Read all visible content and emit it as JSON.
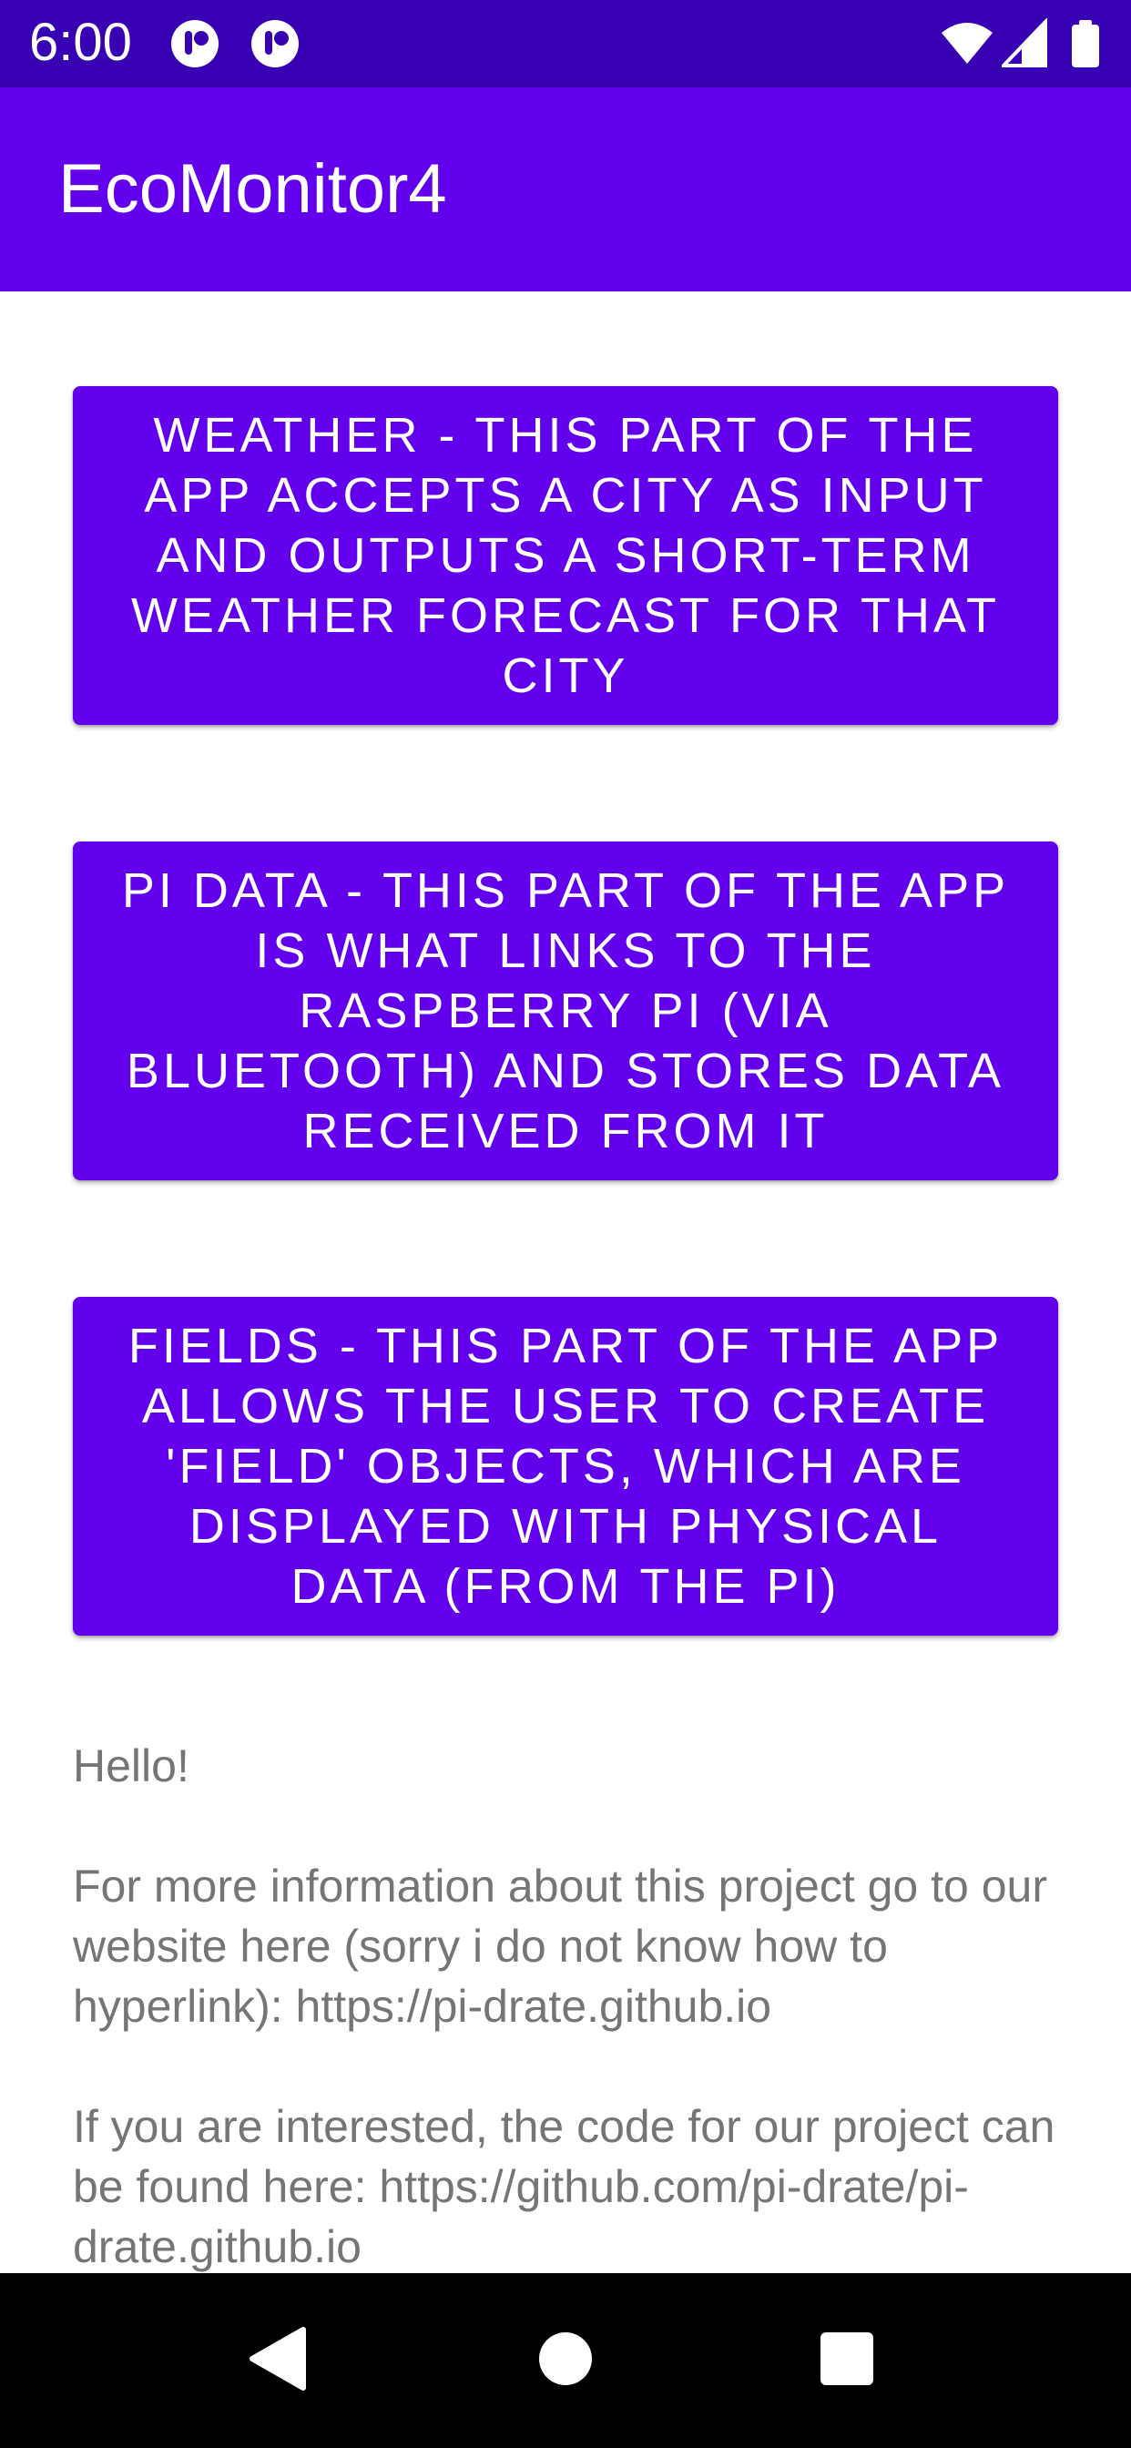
{
  "status_bar": {
    "time": "6:00",
    "icons": [
      "app-notification-icon",
      "app-notification-icon",
      "wifi-icon",
      "cell-signal-icon",
      "battery-icon"
    ]
  },
  "app_bar": {
    "title": "EcoMonitor4"
  },
  "buttons": {
    "weather_label": "Weather - this part of the app accepts a city as input and outputs a short-term weather forecast for that city",
    "pi_data_label": "Pi Data - this part of the app is what links to the Raspberry Pi (via Bluetooth) and stores data received from it",
    "fields_label": "Fields - this part of the app allows the user to create 'field' objects, which are displayed with physical data (from the Pi)"
  },
  "info": {
    "greeting": "Hello!",
    "website_text": "For more information about this project go to our website here (sorry i do not know how to hyperlink): https://pi-drate.github.io",
    "code_text": "If you are interested, the code for our project can be found here: https://github.com/pi-drate/pi-drate.github.io"
  },
  "nav_bar": {
    "icons": [
      "back-icon",
      "home-icon",
      "recents-icon"
    ]
  },
  "colors": {
    "status_bar": "#3700b3",
    "primary": "#6200ee",
    "button_text": "#ffffff",
    "body_text": "#757575",
    "nav_bar": "#000000"
  }
}
